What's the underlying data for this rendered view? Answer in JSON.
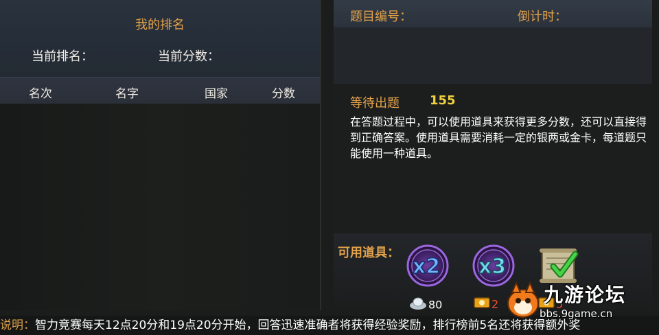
{
  "ranking_panel": {
    "title": "我的排名",
    "current_rank_label": "当前排名：",
    "current_score_label": "当前分数：",
    "columns": [
      "名次",
      "名字",
      "国家",
      "分数"
    ],
    "rows": []
  },
  "question_panel": {
    "question_number_label": "题目编号：",
    "countdown_label": "倒计时：",
    "waiting_label": "等待出题",
    "waiting_value": "155",
    "info_text": "在答题过程中，可以使用道具来获得更多分数，还可以直接得到正确答案。使用道具需要消耗一定的银两或金卡，每道题只能使用一种道具。"
  },
  "items_panel": {
    "label": "可用道具：",
    "items": [
      {
        "name": "x2",
        "icon": "double-score-icon",
        "cost_icon": "silver-ingot-icon",
        "cost": "80",
        "color": "#8a4fd0"
      },
      {
        "name": "x3",
        "icon": "triple-score-icon",
        "cost_icon": "gold-card-icon",
        "cost": "2",
        "color": "#8a4fd0"
      },
      {
        "name": "answer",
        "icon": "answer-scroll-icon",
        "cost_icon": "gold-card-icon",
        "cost": "5",
        "color": "#3cbf3c"
      }
    ]
  },
  "notice": {
    "label": "说明：",
    "text": "智力竞赛每天12点20分和19点20分开始，回答迅速准确者将获得经验奖励，排行榜前5名还将获得额外奖"
  },
  "watermark": {
    "title": "九游论坛",
    "url": "bbs.9game.cn"
  },
  "colors": {
    "accent_orange": "#e2a14a",
    "value_yellow": "#f0d040",
    "cost_red": "#ff4a30"
  }
}
